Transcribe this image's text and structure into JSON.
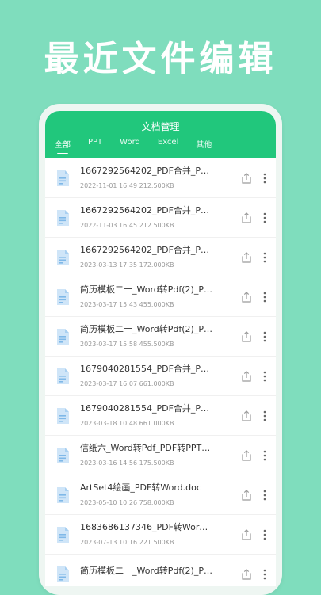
{
  "headline": "最近文件编辑",
  "app": {
    "title": "文档管理",
    "tabs": [
      "全部",
      "PPT",
      "Word",
      "Excel",
      "其他"
    ],
    "active_tab": 0
  },
  "files": [
    {
      "name": "1667292564202_PDF合并_PDF...",
      "info": "2022-11-01 16:49 212.500KB"
    },
    {
      "name": "1667292564202_PDF合并_PDF...",
      "info": "2022-11-03 16:45 212.500KB"
    },
    {
      "name": "1667292564202_PDF合并_PDF...",
      "info": "2023-03-13 17:35 172.000KB"
    },
    {
      "name": "简历模板二十_Word转Pdf(2)_PD...",
      "info": "2023-03-17 15:43 455.000KB"
    },
    {
      "name": "简历模板二十_Word转Pdf(2)_PD...",
      "info": "2023-03-17 15:58 455.500KB"
    },
    {
      "name": "1679040281554_PDF合并_PDF...",
      "info": "2023-03-17 16:07 661.000KB"
    },
    {
      "name": "1679040281554_PDF合并_PDF...",
      "info": "2023-03-18 10:48 661.000KB"
    },
    {
      "name": "信纸六_Word转Pdf_PDF转PPTX_...",
      "info": "2023-03-16 14:56 175.500KB"
    },
    {
      "name": "ArtSet4绘画_PDF转Word.doc",
      "info": "2023-05-10 10:26 758.000KB"
    },
    {
      "name": "1683686137346_PDF转Word.doc",
      "info": "2023-07-13 10:16 221.500KB"
    },
    {
      "name": "简历模板二十_Word转Pdf(2)_PD...",
      "info": ""
    }
  ],
  "colors": {
    "background": "#7fddbd",
    "header": "#21c77c",
    "icon": "#7fb8e8"
  },
  "icons": {
    "file": "file-doc-icon",
    "share": "share-icon",
    "more": "more-vertical-icon"
  }
}
